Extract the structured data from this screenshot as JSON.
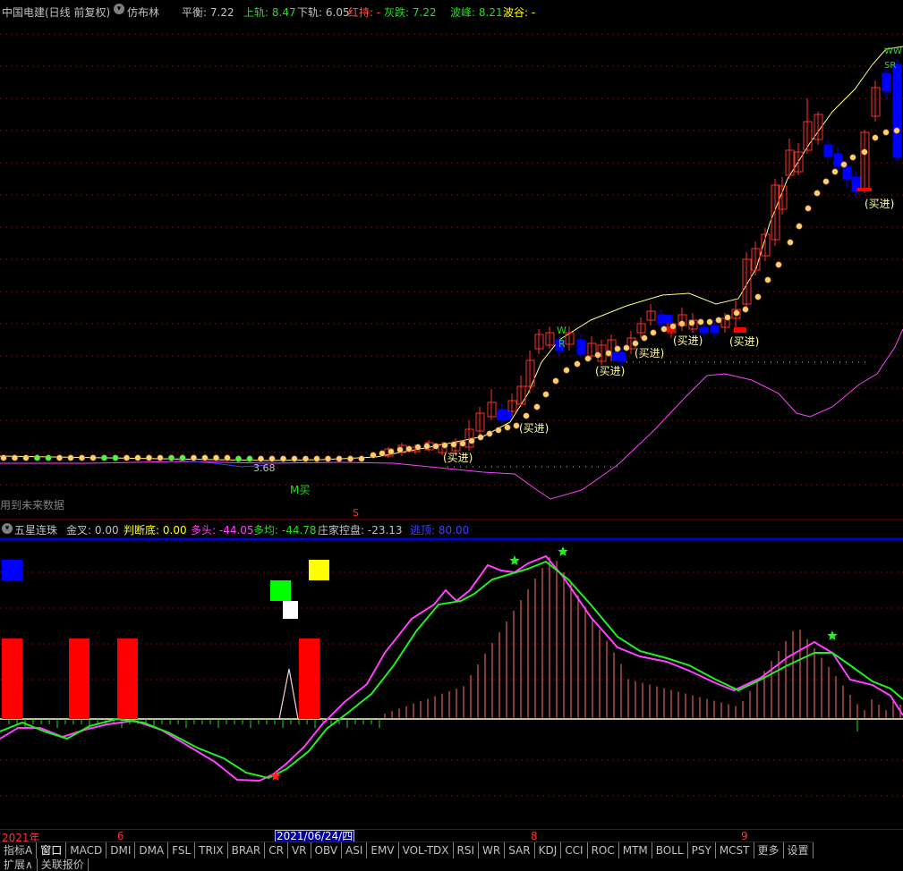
{
  "header": {
    "stock_title": "中国电建(日线 前复权)",
    "indicator_name": "仿布林",
    "items": [
      {
        "label": "平衡:",
        "value": "7.22",
        "color": "#c0c0c0"
      },
      {
        "label": "上轨:",
        "value": "8.47",
        "color": "#22dd22"
      },
      {
        "label": "下轨:",
        "value": "6.05",
        "color": "#c0c0c0"
      },
      {
        "label": "红持:",
        "value": "-",
        "color": "#ff5555"
      },
      {
        "label": "灰跌:",
        "value": "7.22",
        "color": "#22dd22"
      },
      {
        "label": "波峰:",
        "value": "8.21",
        "color": "#22dd22"
      },
      {
        "label": "波谷:",
        "value": "-",
        "color": "#ffff00"
      }
    ]
  },
  "main_chart": {
    "future_data_note": "用到未来数据",
    "low_price_label": "3.68",
    "m_buy_label": "M买",
    "s_label": "S",
    "w_label": "W",
    "r_label": "R",
    "ww_label": "WW",
    "sr_label": "SR",
    "buy_labels": [
      "(买进)",
      "(买进)",
      "(买进)",
      "(买进)",
      "(买进)",
      "(买进)",
      "(买进)"
    ]
  },
  "indicator": {
    "name": "五星连珠",
    "items": [
      {
        "label": "金叉:",
        "value": "0.00",
        "color": "#c0c0c0"
      },
      {
        "label": "判断底:",
        "value": "0.00",
        "color": "#ffff00"
      },
      {
        "label": "多头:",
        "value": "-44.05",
        "color": "#ff40ff"
      },
      {
        "label": "多均:",
        "value": "-44.78",
        "color": "#22dd22"
      },
      {
        "label": "庄家控盘:",
        "value": "-23.13",
        "color": "#c0c0c0"
      },
      {
        "label": "逃顶:",
        "value": "80.00",
        "color": "#4040ff"
      }
    ]
  },
  "date_axis": {
    "labels": [
      "2021年",
      "6",
      "2021/06/24/四",
      "8",
      "9"
    ]
  },
  "tabs": [
    "指标A",
    "窗口",
    "MACD",
    "DMI",
    "DMA",
    "FSL",
    "TRIX",
    "BRAR",
    "CR",
    "VR",
    "OBV",
    "ASI",
    "EMV",
    "VOL-TDX",
    "RSI",
    "WR",
    "SAR",
    "KDJ",
    "CCI",
    "ROC",
    "MTM",
    "BOLL",
    "PSY",
    "MCST",
    "更多",
    "设置"
  ],
  "ext_tabs": [
    "扩展∧",
    "关联报价"
  ],
  "colors": {
    "up_candle": "#ff3030",
    "down_candle": "#0000ff",
    "upper_band": "#ffff80",
    "lower_band": "#ff40ff",
    "sar_dot": "#ffd070",
    "grid": "#800000",
    "magenta_line": "#ff40ff",
    "green_line": "#22ee22"
  }
}
